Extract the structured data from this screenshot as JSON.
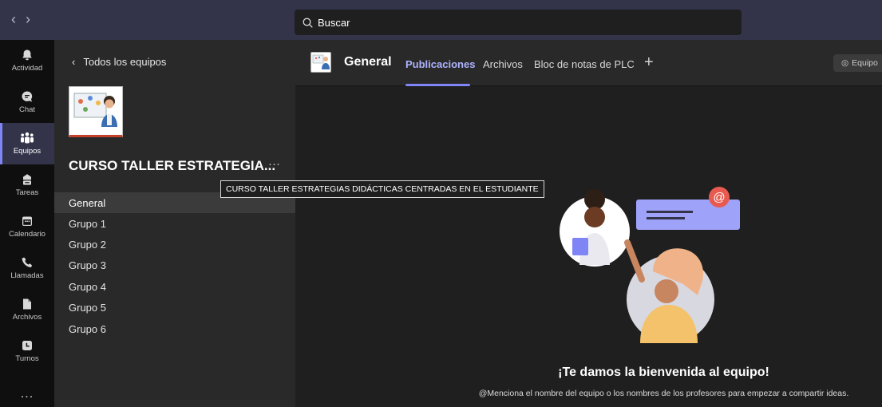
{
  "topbar": {
    "back": "‹",
    "forward": "›",
    "search_placeholder": "Buscar"
  },
  "rail": {
    "items": [
      {
        "label": "Actividad",
        "icon": "bell-icon"
      },
      {
        "label": "Chat",
        "icon": "chat-icon"
      },
      {
        "label": "Equipos",
        "icon": "teams-icon",
        "active": true
      },
      {
        "label": "Tareas",
        "icon": "assignments-icon"
      },
      {
        "label": "Calendario",
        "icon": "calendar-icon"
      },
      {
        "label": "Llamadas",
        "icon": "phone-icon"
      },
      {
        "label": "Archivos",
        "icon": "file-icon"
      },
      {
        "label": "Turnos",
        "icon": "shifts-icon"
      }
    ],
    "more": "..."
  },
  "teampanel": {
    "back_label": "Todos los equipos",
    "team_name": "CURSO TALLER ESTRATEGIA...",
    "team_more": "···",
    "tooltip": "CURSO TALLER ESTRATEGIAS DIDÁCTICAS CENTRADAS EN EL ESTUDIANTE",
    "channels": [
      "General",
      "Grupo 1",
      "Grupo 2",
      "Grupo 3",
      "Grupo 4",
      "Grupo 5",
      "Grupo 6"
    ]
  },
  "main": {
    "title": "General",
    "tabs": [
      "Publicaciones",
      "Archivos",
      "Bloc de notas de PLC"
    ],
    "add_tab": "+",
    "team_button": "Equipo",
    "welcome_title": "¡Te damos la bienvenida al equipo!",
    "welcome_sub": "@Menciona el nombre del equipo o los nombres de los profesores para empezar a compartir ideas."
  },
  "colors": {
    "accent": "#7f85f5",
    "topbar": "#33344a",
    "rail": "#0f0f0f",
    "panel": "#292929",
    "content": "#1f1f1f",
    "mention": "#e74c3c"
  }
}
